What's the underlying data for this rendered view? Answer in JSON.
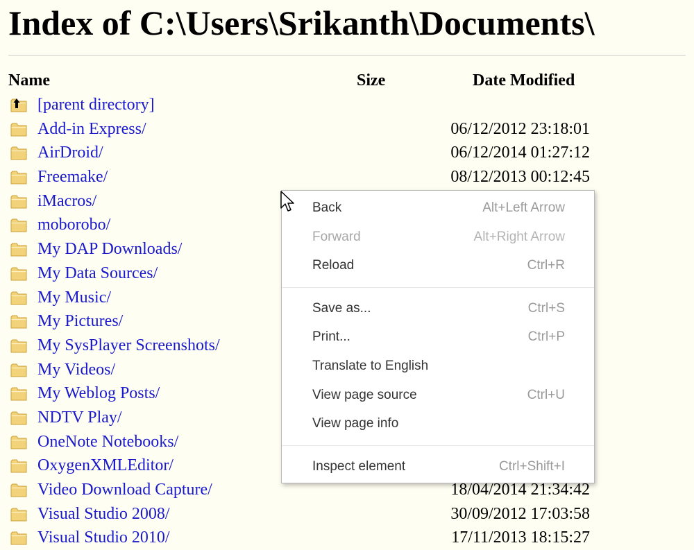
{
  "page": {
    "title": "Index of C:\\Users\\Srikanth\\Documents\\"
  },
  "columns": {
    "name": "Name",
    "size": "Size",
    "date": "Date Modified"
  },
  "entries": [
    {
      "name": "[parent directory]",
      "size": "",
      "date": "",
      "icon": "parent-folder-icon"
    },
    {
      "name": "Add-in Express/",
      "size": "",
      "date": "06/12/2012 23:18:01",
      "icon": "folder-icon"
    },
    {
      "name": "AirDroid/",
      "size": "",
      "date": "06/12/2014 01:27:12",
      "icon": "folder-icon"
    },
    {
      "name": "Freemake/",
      "size": "",
      "date": "08/12/2013 00:12:45",
      "icon": "folder-icon"
    },
    {
      "name": "iMacros/",
      "size": "",
      "date": "",
      "icon": "folder-icon"
    },
    {
      "name": "moborobo/",
      "size": "",
      "date": "",
      "icon": "folder-icon"
    },
    {
      "name": "My DAP Downloads/",
      "size": "",
      "date": "",
      "icon": "folder-icon"
    },
    {
      "name": "My Data Sources/",
      "size": "",
      "date": "",
      "icon": "folder-icon"
    },
    {
      "name": "My Music/",
      "size": "",
      "date": "",
      "icon": "folder-icon"
    },
    {
      "name": "My Pictures/",
      "size": "",
      "date": "",
      "icon": "folder-icon"
    },
    {
      "name": "My SysPlayer Screenshots/",
      "size": "",
      "date": "",
      "icon": "folder-icon"
    },
    {
      "name": "My Videos/",
      "size": "",
      "date": "",
      "icon": "folder-icon"
    },
    {
      "name": "My Weblog Posts/",
      "size": "",
      "date": "",
      "icon": "folder-icon"
    },
    {
      "name": "NDTV Play/",
      "size": "",
      "date": "",
      "icon": "folder-icon"
    },
    {
      "name": "OneNote Notebooks/",
      "size": "",
      "date": "",
      "icon": "folder-icon"
    },
    {
      "name": "OxygenXMLEditor/",
      "size": "",
      "date": "",
      "icon": "folder-icon"
    },
    {
      "name": "Video Download Capture/",
      "size": "",
      "date": "18/04/2014 21:34:42",
      "icon": "folder-icon"
    },
    {
      "name": "Visual Studio 2008/",
      "size": "",
      "date": "30/09/2012 17:03:58",
      "icon": "folder-icon"
    },
    {
      "name": "Visual Studio 2010/",
      "size": "",
      "date": "17/11/2013 18:15:27",
      "icon": "folder-icon"
    }
  ],
  "context_menu": {
    "groups": [
      [
        {
          "label": "Back",
          "shortcut": "Alt+Left Arrow",
          "disabled": false
        },
        {
          "label": "Forward",
          "shortcut": "Alt+Right Arrow",
          "disabled": true
        },
        {
          "label": "Reload",
          "shortcut": "Ctrl+R",
          "disabled": false
        }
      ],
      [
        {
          "label": "Save as...",
          "shortcut": "Ctrl+S",
          "disabled": false
        },
        {
          "label": "Print...",
          "shortcut": "Ctrl+P",
          "disabled": false
        },
        {
          "label": "Translate to English",
          "shortcut": "",
          "disabled": false
        },
        {
          "label": "View page source",
          "shortcut": "Ctrl+U",
          "disabled": false
        },
        {
          "label": "View page info",
          "shortcut": "",
          "disabled": false
        }
      ],
      [
        {
          "label": "Inspect element",
          "shortcut": "Ctrl+Shift+I",
          "disabled": false
        }
      ]
    ]
  },
  "colors": {
    "background": "#fffef2",
    "link": "#1a1acc",
    "folder": "#f2d27a",
    "folder_dark": "#c9a13a"
  },
  "cursor": {
    "icon": "arrow-cursor-icon"
  }
}
